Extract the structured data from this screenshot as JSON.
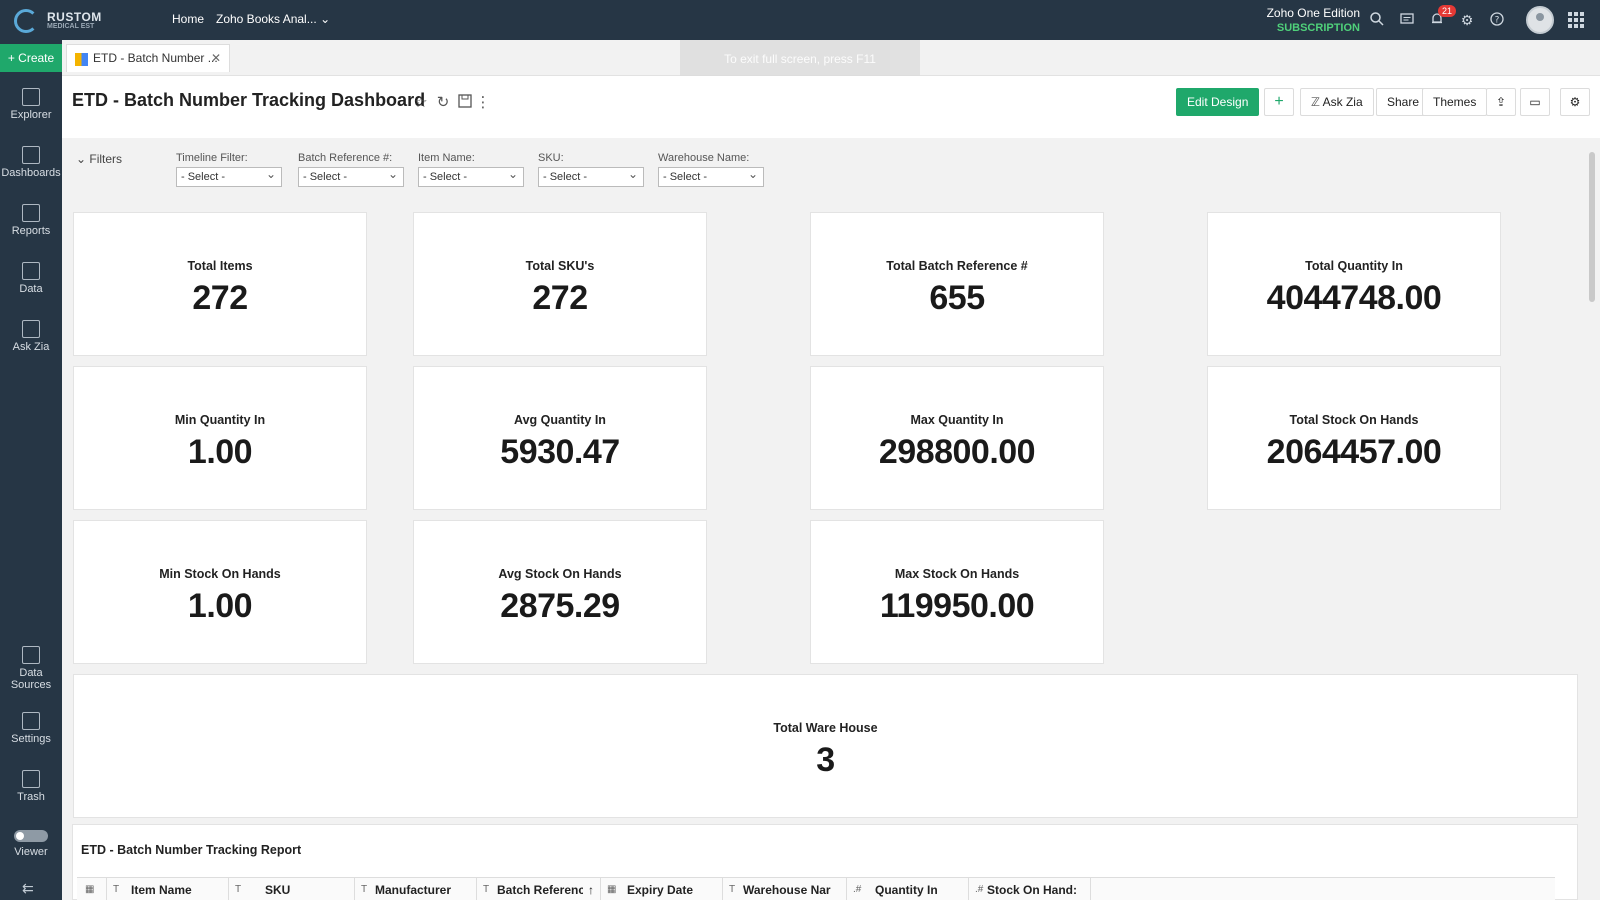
{
  "topbar": {
    "logo_line1": "RUSTOM",
    "logo_line2": "MEDICAL EST",
    "nav_home": "Home",
    "nav_workspace": "Zoho Books Anal...",
    "edition": "Zoho One Edition",
    "subscription": "SUBSCRIPTION",
    "notifications_count": "21",
    "icons": [
      "search-icon",
      "chat-icon",
      "bell-icon",
      "gear-icon",
      "help-icon",
      "avatar",
      "apps-grid-icon"
    ]
  },
  "sidebar": {
    "create_label": "Create",
    "items": [
      {
        "label": "Explorer"
      },
      {
        "label": "Dashboards"
      },
      {
        "label": "Reports"
      },
      {
        "label": "Data"
      },
      {
        "label": "Ask Zia"
      }
    ],
    "bottom_items": [
      {
        "label": "Data Sources"
      },
      {
        "label": "Settings"
      },
      {
        "label": "Trash"
      },
      {
        "label": "Viewer"
      }
    ]
  },
  "tab": {
    "label": "ETD - Batch Number ...",
    "close": "✕"
  },
  "fullscreen_notice": "To exit full screen, press F11",
  "dashboard": {
    "title": "ETD - Batch Number Tracking Dashboard",
    "buttons": {
      "edit_design": "Edit Design",
      "add": "+",
      "ask_zia": "Ask Zia",
      "share": "Share",
      "themes": "Themes"
    }
  },
  "filters": {
    "toggle_label": "Filters",
    "items": [
      {
        "label": "Timeline Filter:",
        "value": "- Select -"
      },
      {
        "label": "Batch Reference #:",
        "value": "- Select -"
      },
      {
        "label": "Item Name:",
        "value": "- Select -"
      },
      {
        "label": "SKU:",
        "value": "- Select -"
      },
      {
        "label": "Warehouse Name:",
        "value": "- Select -"
      }
    ]
  },
  "kpis": [
    {
      "label": "Total Items",
      "value": "272"
    },
    {
      "label": "Total SKU's",
      "value": "272"
    },
    {
      "label": "Total Batch Reference #",
      "value": "655"
    },
    {
      "label": "Total Quantity In",
      "value": "4044748.00"
    },
    {
      "label": "Min Quantity In",
      "value": "1.00"
    },
    {
      "label": "Avg Quantity In",
      "value": "5930.47"
    },
    {
      "label": "Max Quantity In",
      "value": "298800.00"
    },
    {
      "label": "Total Stock On Hands",
      "value": "2064457.00"
    },
    {
      "label": "Min Stock On Hands",
      "value": "1.00"
    },
    {
      "label": "Avg Stock On Hands",
      "value": "2875.29"
    },
    {
      "label": "Max Stock On Hands",
      "value": "119950.00"
    },
    {
      "label": "Total Ware House",
      "value": "3"
    }
  ],
  "report": {
    "title": "ETD - Batch Number Tracking Report",
    "columns": [
      {
        "type": "T",
        "name": "Item Name"
      },
      {
        "type": "T",
        "name": "SKU"
      },
      {
        "type": "T",
        "name": "Manufacturer"
      },
      {
        "type": "T",
        "name": "Batch Referenc"
      },
      {
        "type": "▦",
        "name": "Expiry Date"
      },
      {
        "type": "T",
        "name": "Warehouse Nar"
      },
      {
        "type": ".#",
        "name": "Quantity In"
      },
      {
        "type": ".#",
        "name": "Stock On Hand:"
      }
    ]
  }
}
